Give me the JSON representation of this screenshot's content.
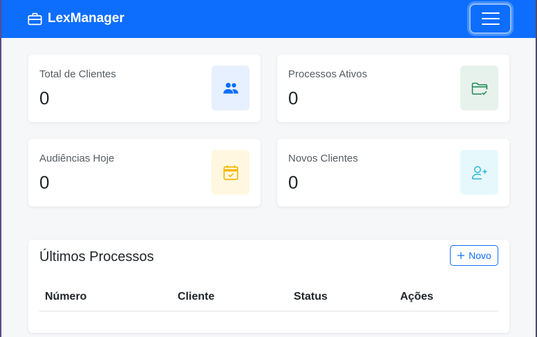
{
  "navbar": {
    "brand": "LexManager",
    "brand_icon": "briefcase-icon",
    "toggler_icon": "hamburger-icon",
    "color": "#0d6efd"
  },
  "stats": [
    {
      "label": "Total de Clientes",
      "value": "0",
      "icon": "people-icon",
      "icon_color": "#0d6efd",
      "icon_bg": "#e7f0fe"
    },
    {
      "label": "Processos Ativos",
      "value": "0",
      "icon": "folder-check-icon",
      "icon_color": "#198754",
      "icon_bg": "#e8f2ec"
    },
    {
      "label": "Audiências Hoje",
      "value": "0",
      "icon": "calendar-check-icon",
      "icon_color": "#f5b800",
      "icon_bg": "#fff7e0"
    },
    {
      "label": "Novos Clientes",
      "value": "0",
      "icon": "person-plus-icon",
      "icon_color": "#22b8d6",
      "icon_bg": "#e7f8fc"
    }
  ],
  "processes": {
    "title": "Últimos Processos",
    "new_button": "Novo",
    "columns": [
      "Número",
      "Cliente",
      "Status",
      "Ações"
    ]
  }
}
